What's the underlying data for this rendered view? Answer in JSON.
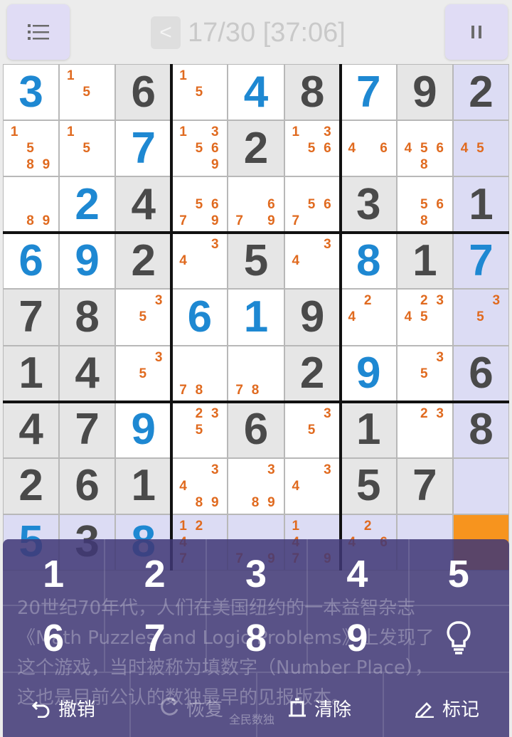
{
  "header": {
    "back_glyph": "<",
    "title": "17/30 [37:06]",
    "pause_glyph": "II"
  },
  "board": {
    "rows": [
      [
        "3b",
        "n15",
        "6g",
        "n15",
        "4b",
        "8g",
        "7b",
        "9g",
        "2g"
      ],
      [
        "n1589",
        "n15",
        "7b",
        "n13569",
        "2g",
        "n1356",
        "n46",
        "n4568",
        "n45"
      ],
      [
        "n89",
        "2b",
        "4g",
        "n5679",
        "n679",
        "n567",
        "3g",
        "n568",
        "1g"
      ],
      [
        "6b",
        "9b",
        "2g",
        "n34",
        "5g",
        "n34",
        "8b",
        "1g",
        "7b"
      ],
      [
        "7g",
        "8g",
        "n35",
        "6b",
        "1b",
        "9g",
        "n24",
        "n2345",
        "n35"
      ],
      [
        "1g",
        "4g",
        "n35",
        "n78",
        "n78",
        "2g",
        "9b",
        "n35",
        "6g"
      ],
      [
        "4g",
        "7g",
        "9b",
        "n235",
        "6g",
        "n35",
        "1g",
        "n23",
        "8g"
      ],
      [
        "2g",
        "6g",
        "1g",
        "n3489",
        "n389",
        "n34",
        "5g",
        "7g",
        "e"
      ],
      [
        "5b",
        "3g",
        "8b",
        "n1247",
        "n79",
        "n1479",
        "n246",
        "e",
        "s"
      ]
    ]
  },
  "keypad": {
    "row1": [
      "1",
      "2",
      "3",
      "4",
      "5"
    ],
    "row2": [
      "6",
      "7",
      "8",
      "9"
    ],
    "hint_icon": "lightbulb-icon",
    "description": "20世纪70年代，人们在美国纽约的一本益智杂志《Math Puzzles and Logic Problems》上发现了这个游戏，当时被称为填数字（Number Place），这也是目前公认的数独最早的见报版本。",
    "actions": {
      "undo": "撤销",
      "redo": "恢复",
      "clear": "清除",
      "mark": "标记"
    },
    "watermark": "全民数独"
  },
  "colors": {
    "given_digit": "#4a4a4a",
    "user_digit": "#1e88d2",
    "note_digit": "#e06a1f",
    "selected_cell": "#f7941e",
    "highlight": "#dcdcf4",
    "keypad_bg": "#403876"
  }
}
